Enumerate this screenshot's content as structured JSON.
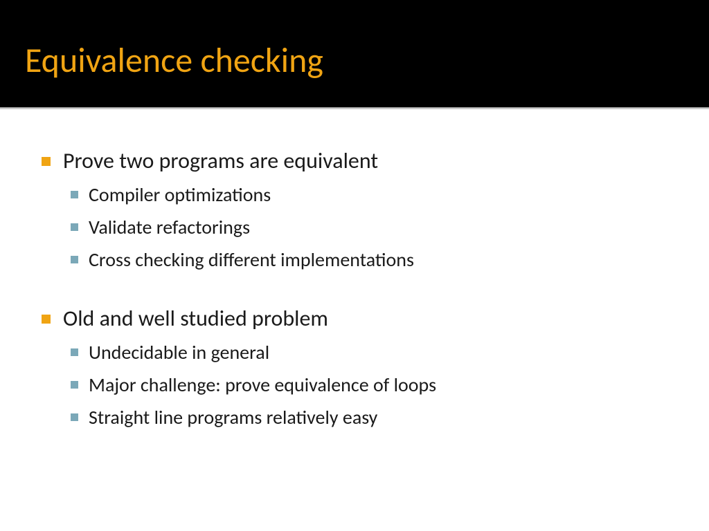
{
  "title": "Equivalence checking",
  "colors": {
    "titleBg": "#000000",
    "titleText": "#f0a413",
    "bulletL1": "#f0a413",
    "bulletL2": "#7ba8b8",
    "bodyText": "#1a1a1a"
  },
  "bullets": [
    {
      "text": "Prove two programs are equivalent",
      "children": [
        {
          "text": "Compiler optimizations"
        },
        {
          "text": "Validate refactorings"
        },
        {
          "text": "Cross checking different implementations"
        }
      ]
    },
    {
      "text": "Old and well studied problem",
      "children": [
        {
          "text": "Undecidable in general"
        },
        {
          "text": "Major challenge: prove equivalence of loops"
        },
        {
          "text": "Straight line programs relatively easy"
        }
      ]
    }
  ]
}
